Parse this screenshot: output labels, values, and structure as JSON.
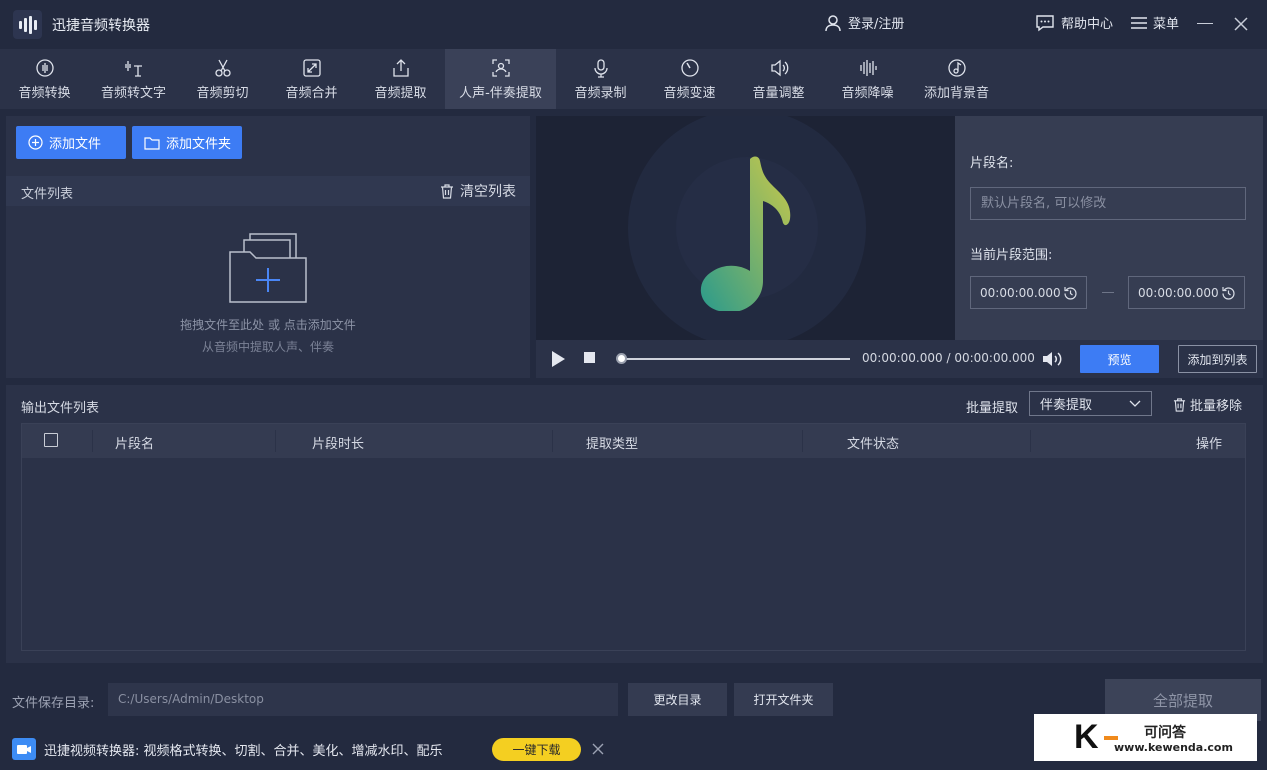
{
  "app": {
    "title": "迅捷音频转换器"
  },
  "header": {
    "login": "登录/注册",
    "help": "帮助中心",
    "menu": "菜单"
  },
  "tabs": [
    {
      "label": "音频转换",
      "icon": "audio-convert-icon"
    },
    {
      "label": "音频转文字",
      "icon": "audio-to-text-icon"
    },
    {
      "label": "音频剪切",
      "icon": "scissors-icon"
    },
    {
      "label": "音频合并",
      "icon": "merge-icon"
    },
    {
      "label": "音频提取",
      "icon": "extract-icon"
    },
    {
      "label": "人声-伴奏提取",
      "icon": "vocal-separation-icon",
      "active": true
    },
    {
      "label": "音频录制",
      "icon": "microphone-icon"
    },
    {
      "label": "音频变速",
      "icon": "speed-icon"
    },
    {
      "label": "音量调整",
      "icon": "volume-icon"
    },
    {
      "label": "音频降噪",
      "icon": "noise-reduction-icon"
    },
    {
      "label": "添加背景音",
      "icon": "music-note-icon"
    }
  ],
  "files": {
    "add_file": "添加文件",
    "add_folder": "添加文件夹",
    "list_title": "文件列表",
    "clear_list": "清空列表",
    "drop_hint": "拖拽文件至此处 或 点击添加文件",
    "drop_sub": "从音频中提取人声、伴奏"
  },
  "player": {
    "current_time": "00:00:00.000",
    "separator": "/",
    "total_time": "00:00:00.000",
    "preview_btn": "预览",
    "add_to_list_btn": "添加到列表"
  },
  "segment": {
    "name_label": "片段名:",
    "name_placeholder": "默认片段名, 可以修改",
    "range_label": "当前片段范围:",
    "start": "00:00:00.000",
    "end": "00:00:00.000"
  },
  "output": {
    "title": "输出文件列表",
    "batch_label": "批量提取",
    "batch_value": "伴奏提取",
    "batch_remove": "批量移除",
    "columns": [
      "片段名",
      "片段时长",
      "提取类型",
      "文件状态",
      "操作"
    ]
  },
  "footer": {
    "save_label": "文件保存目录:",
    "save_path": "C:/Users/Admin/Desktop",
    "change_dir": "更改目录",
    "open_folder": "打开文件夹",
    "extract_all": "全部提取",
    "promo_text": "迅捷视频转换器: 视频格式转换、切割、合并、美化、增减水印、配乐",
    "download_btn": "一键下载"
  },
  "watermark": {
    "letter": "K",
    "name": "可问答",
    "url": "www.kewenda.com"
  },
  "colors": {
    "accent": "#3d7cf4",
    "background": "#232a3f",
    "panel": "#2b3248",
    "download": "#f4cf21"
  }
}
